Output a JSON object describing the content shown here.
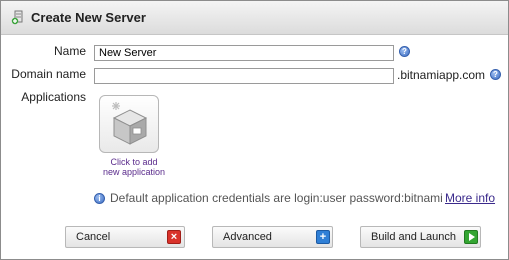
{
  "dialog": {
    "title": "Create New Server",
    "title_icon": "server-plus-icon"
  },
  "form": {
    "name_label": "Name",
    "name_value": "New Server",
    "domain_label": "Domain name",
    "domain_value": "",
    "domain_suffix": ".bitnamiapp.com",
    "applications_label": "Applications",
    "add_app_caption_line1": "Click to add",
    "add_app_caption_line2": "new application",
    "help_icon": "help-icon"
  },
  "info": {
    "icon": "info-icon",
    "text": "Default application credentials are login:user password:bitnami",
    "link": "More info"
  },
  "buttons": {
    "cancel": "Cancel",
    "advanced": "Advanced",
    "launch": "Build and Launch"
  },
  "colors": {
    "cancel_icon": "#d9322a",
    "advanced_icon": "#2f7fd6",
    "launch_icon": "#33a532",
    "caption": "#5b2c8c",
    "link": "#3b2a8c"
  }
}
